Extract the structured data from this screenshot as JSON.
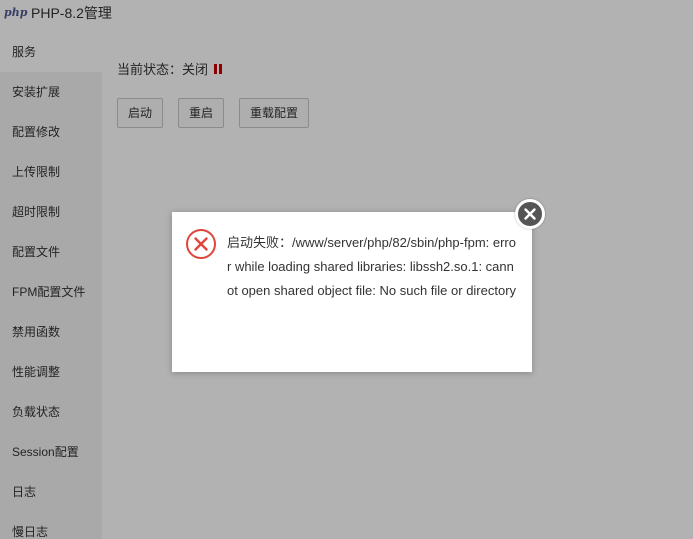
{
  "window": {
    "logo_text": "php",
    "title": "PHP-8.2管理"
  },
  "sidebar": {
    "items": [
      {
        "label": "服务",
        "active": true
      },
      {
        "label": "安装扩展"
      },
      {
        "label": "配置修改"
      },
      {
        "label": "上传限制"
      },
      {
        "label": "超时限制"
      },
      {
        "label": "配置文件"
      },
      {
        "label": "FPM配置文件"
      },
      {
        "label": "禁用函数"
      },
      {
        "label": "性能调整"
      },
      {
        "label": "负载状态"
      },
      {
        "label": "Session配置"
      },
      {
        "label": "日志"
      },
      {
        "label": "慢日志"
      }
    ]
  },
  "main": {
    "status_label": "当前状态：关闭",
    "status_color": "#cc0000",
    "buttons": {
      "start": "启动",
      "restart": "重启",
      "reload": "重载配置"
    }
  },
  "dialog": {
    "icon": "error-x-icon",
    "message": "启动失败：/www/server/php/82/sbin/php-fpm: error while loading shared libraries: libssh2.so.1: cannot open shared object file: No such file or directory",
    "close_icon": "close-icon"
  }
}
